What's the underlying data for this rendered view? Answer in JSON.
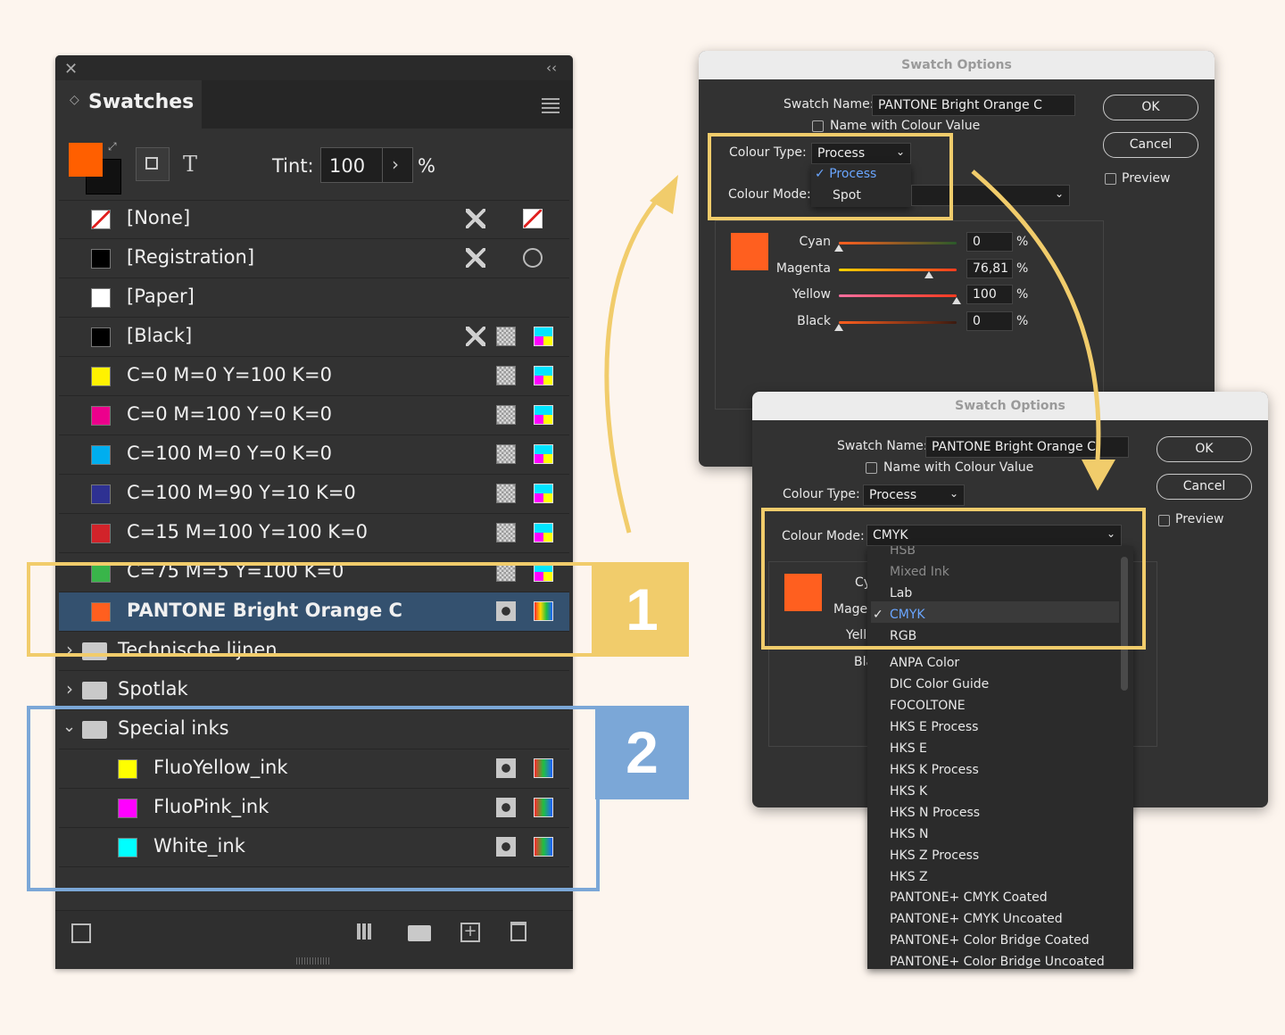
{
  "panel": {
    "title": "Swatches",
    "tint_label": "Tint:",
    "tint_value": "100",
    "tint_unit": "%",
    "text_tool": "T",
    "rows": [
      {
        "label": "[None]",
        "color": null
      },
      {
        "label": "[Registration]",
        "color": "#000000"
      },
      {
        "label": "[Paper]",
        "color": "#ffffff"
      },
      {
        "label": "[Black]",
        "color": "#000000"
      },
      {
        "label": "C=0 M=0 Y=100 K=0",
        "color": "#fff200"
      },
      {
        "label": "C=0 M=100 Y=0 K=0",
        "color": "#ec008c"
      },
      {
        "label": "C=100 M=0 Y=0 K=0",
        "color": "#00aeef"
      },
      {
        "label": "C=100 M=90 Y=10 K=0",
        "color": "#2e3192"
      },
      {
        "label": "C=15 M=100 Y=100 K=0",
        "color": "#d2232a"
      },
      {
        "label": "C=75 M=5 Y=100 K=0",
        "color": "#39b54a"
      },
      {
        "label": "PANTONE Bright Orange C",
        "color": "#ff5f1f",
        "selected": true
      }
    ],
    "groups": [
      {
        "label": "Technische lijnen",
        "expanded": false
      },
      {
        "label": "Spotlak",
        "expanded": false
      },
      {
        "label": "Special inks",
        "expanded": true
      }
    ],
    "group_items": [
      {
        "label": "FluoYellow_ink",
        "color": "#ffff00"
      },
      {
        "label": "FluoPink_ink",
        "color": "#ff00ff"
      },
      {
        "label": "White_ink",
        "color": "#00ffff"
      }
    ]
  },
  "dialog1": {
    "title": "Swatch Options",
    "swatch_name_label": "Swatch Name:",
    "swatch_name": "PANTONE Bright Orange C",
    "name_with_value": "Name with Colour Value",
    "colour_type_label": "Colour Type:",
    "colour_type": "Process",
    "colour_type_options": [
      "Process",
      "Spot"
    ],
    "colour_mode_label": "Colour Mode:",
    "ok": "OK",
    "cancel": "Cancel",
    "preview": "Preview",
    "channels": [
      {
        "label": "Cyan",
        "value": "0",
        "fraction": 0
      },
      {
        "label": "Magenta",
        "value": "76,81",
        "fraction": 0.7681
      },
      {
        "label": "Yellow",
        "value": "100",
        "fraction": 1.0
      },
      {
        "label": "Black",
        "value": "0",
        "fraction": 0
      }
    ],
    "pct": "%"
  },
  "dialog2": {
    "title": "Swatch Options",
    "swatch_name_label": "Swatch Name:",
    "swatch_name": "PANTONE Bright Orange C",
    "name_with_value": "Name with Colour Value",
    "colour_type_label": "Colour Type:",
    "colour_type": "Process",
    "colour_mode_label": "Colour Mode:",
    "colour_mode": "CMYK",
    "ok": "OK",
    "cancel": "Cancel",
    "preview": "Preview",
    "partial_labels": [
      "Cy",
      "Mage",
      "Yell",
      "Bla"
    ],
    "mode_options": [
      "HSB",
      "Mixed Ink",
      "Lab",
      "CMYK",
      "RGB",
      "ANPA Color",
      "DIC Color Guide",
      "FOCOLTONE",
      "HKS E Process",
      "HKS E",
      "HKS K Process",
      "HKS K",
      "HKS N Process",
      "HKS N",
      "HKS Z Process",
      "HKS Z",
      "PANTONE+ CMYK Coated",
      "PANTONE+ CMYK Uncoated",
      "PANTONE+ Color Bridge Coated",
      "PANTONE+ Color Bridge Uncoated"
    ]
  },
  "badges": {
    "one": "1",
    "two": "2"
  },
  "colors": {
    "highlight_yellow": "#f1cc6b",
    "highlight_blue": "#7ba7d7",
    "swatch_orange": "#ff5f1f",
    "selection_blue": "#34516f"
  }
}
